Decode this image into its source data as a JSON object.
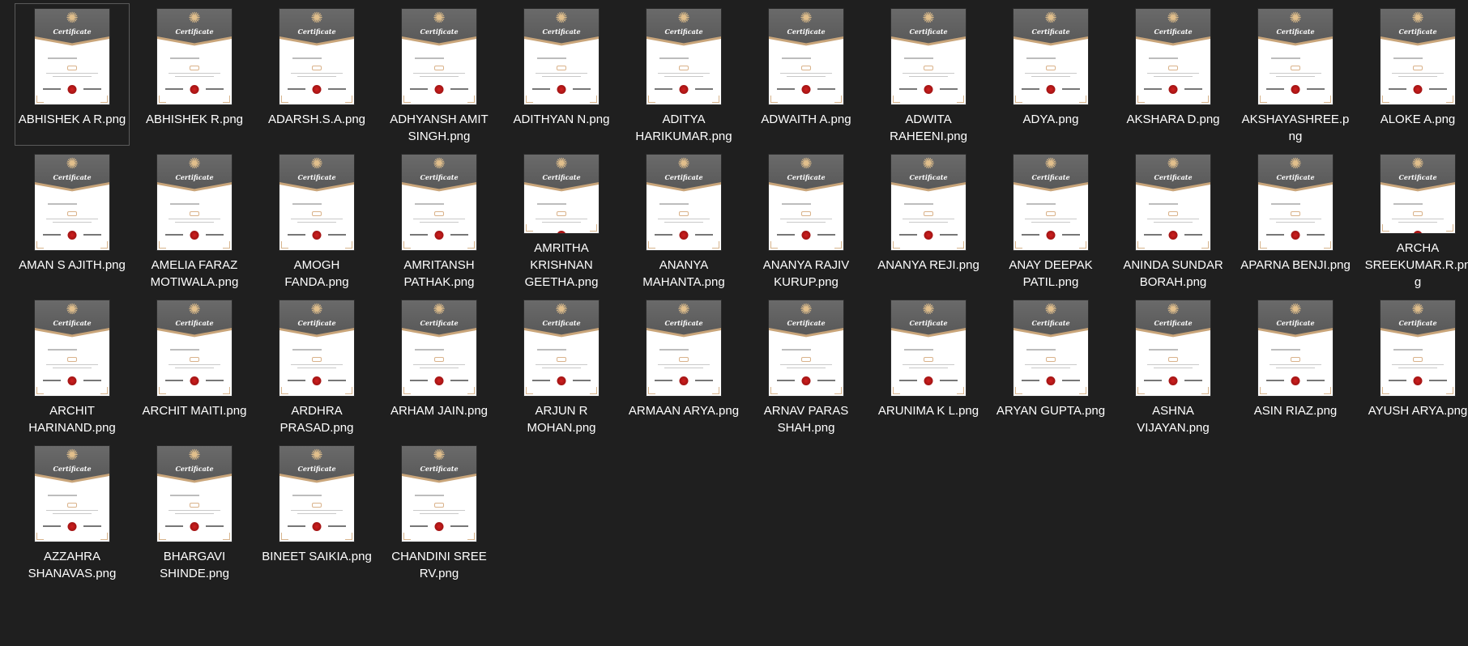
{
  "files": [
    {
      "name": "ABHISHEK A R.png",
      "selected": true
    },
    {
      "name": "ABHISHEK R.png"
    },
    {
      "name": "ADARSH.S.A.png"
    },
    {
      "name": "ADHYANSH AMIT SINGH.png"
    },
    {
      "name": "ADITHYAN N.png"
    },
    {
      "name": "ADITYA HARIKUMAR.png"
    },
    {
      "name": "ADWAITH A.png"
    },
    {
      "name": "ADWITA RAHEENI.png"
    },
    {
      "name": "ADYA.png"
    },
    {
      "name": "AKSHARA D.png"
    },
    {
      "name": "AKSHAYASHREE.png"
    },
    {
      "name": "ALOKE A.png"
    },
    {
      "name": "AMAN S AJITH.png"
    },
    {
      "name": "AMELIA FARAZ MOTIWALA.png"
    },
    {
      "name": "AMOGH FANDA.png"
    },
    {
      "name": "AMRITANSH PATHAK.png"
    },
    {
      "name": "AMRITHA KRISHNAN GEETHA.png"
    },
    {
      "name": "ANANYA MAHANTA.png"
    },
    {
      "name": "ANANYA RAJIV KURUP.png"
    },
    {
      "name": "ANANYA REJI.png"
    },
    {
      "name": "ANAY DEEPAK PATIL.png"
    },
    {
      "name": "ANINDA SUNDAR BORAH.png"
    },
    {
      "name": "APARNA BENJI.png"
    },
    {
      "name": "ARCHA SREEKUMAR.R.png"
    },
    {
      "name": "ARCHIT HARINAND.png"
    },
    {
      "name": "ARCHIT MAITI.png"
    },
    {
      "name": "ARDHRA PRASAD.png"
    },
    {
      "name": "ARHAM JAIN.png"
    },
    {
      "name": "ARJUN R MOHAN.png"
    },
    {
      "name": "ARMAAN ARYA.png"
    },
    {
      "name": "ARNAV PARAS SHAH.png"
    },
    {
      "name": "ARUNIMA K L.png"
    },
    {
      "name": "ARYAN GUPTA.png"
    },
    {
      "name": "ASHNA VIJAYAN.png"
    },
    {
      "name": "ASIN RIAZ.png"
    },
    {
      "name": "AYUSH ARYA.png"
    },
    {
      "name": "AZZAHRA SHANAVAS.png"
    },
    {
      "name": "BHARGAVI SHINDE.png"
    },
    {
      "name": "BINEET SAIKIA.png"
    },
    {
      "name": "CHANDINI SREE RV.png"
    }
  ],
  "thumbnail": {
    "heading": "Certificate",
    "icon": "certificate-thumbnail-icon",
    "colors": {
      "band": "#5e5e5e",
      "gold": "#c9a57a",
      "seal": "#b01515",
      "background": "#1f1f1f",
      "text": "#ffffff"
    }
  }
}
